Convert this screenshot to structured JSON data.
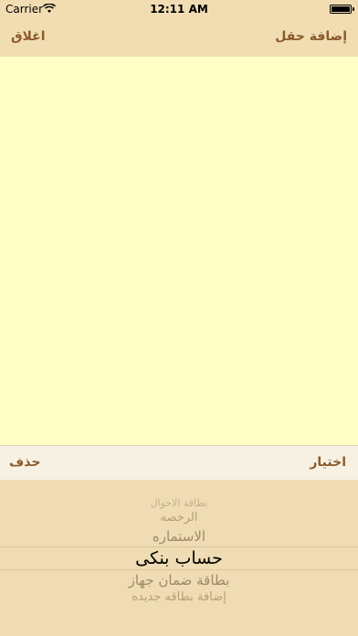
{
  "status_bar": {
    "carrier": "Carrier",
    "time": "12:11 AM",
    "wifi_icon": "wifi-icon",
    "battery_icon": "battery-icon"
  },
  "nav": {
    "left_button": "اغلاق",
    "right_button": "إضافة حقل"
  },
  "toolbar": {
    "left_button": "حذف",
    "right_button": "اختيار"
  },
  "picker": {
    "items": [
      "بطاقة الاحوال",
      "الرخصه",
      "الاستماره",
      "حساب بنكى",
      "بطاقة ضمان جهاز",
      "إضافة بطاقه جديده"
    ],
    "selected": "حساب بنكى"
  },
  "colors": {
    "bar_background": "#f2ddb3",
    "content_background": "#ffffc6",
    "accent_text": "#8a5a2b",
    "picker_background": "#efdcb4"
  }
}
